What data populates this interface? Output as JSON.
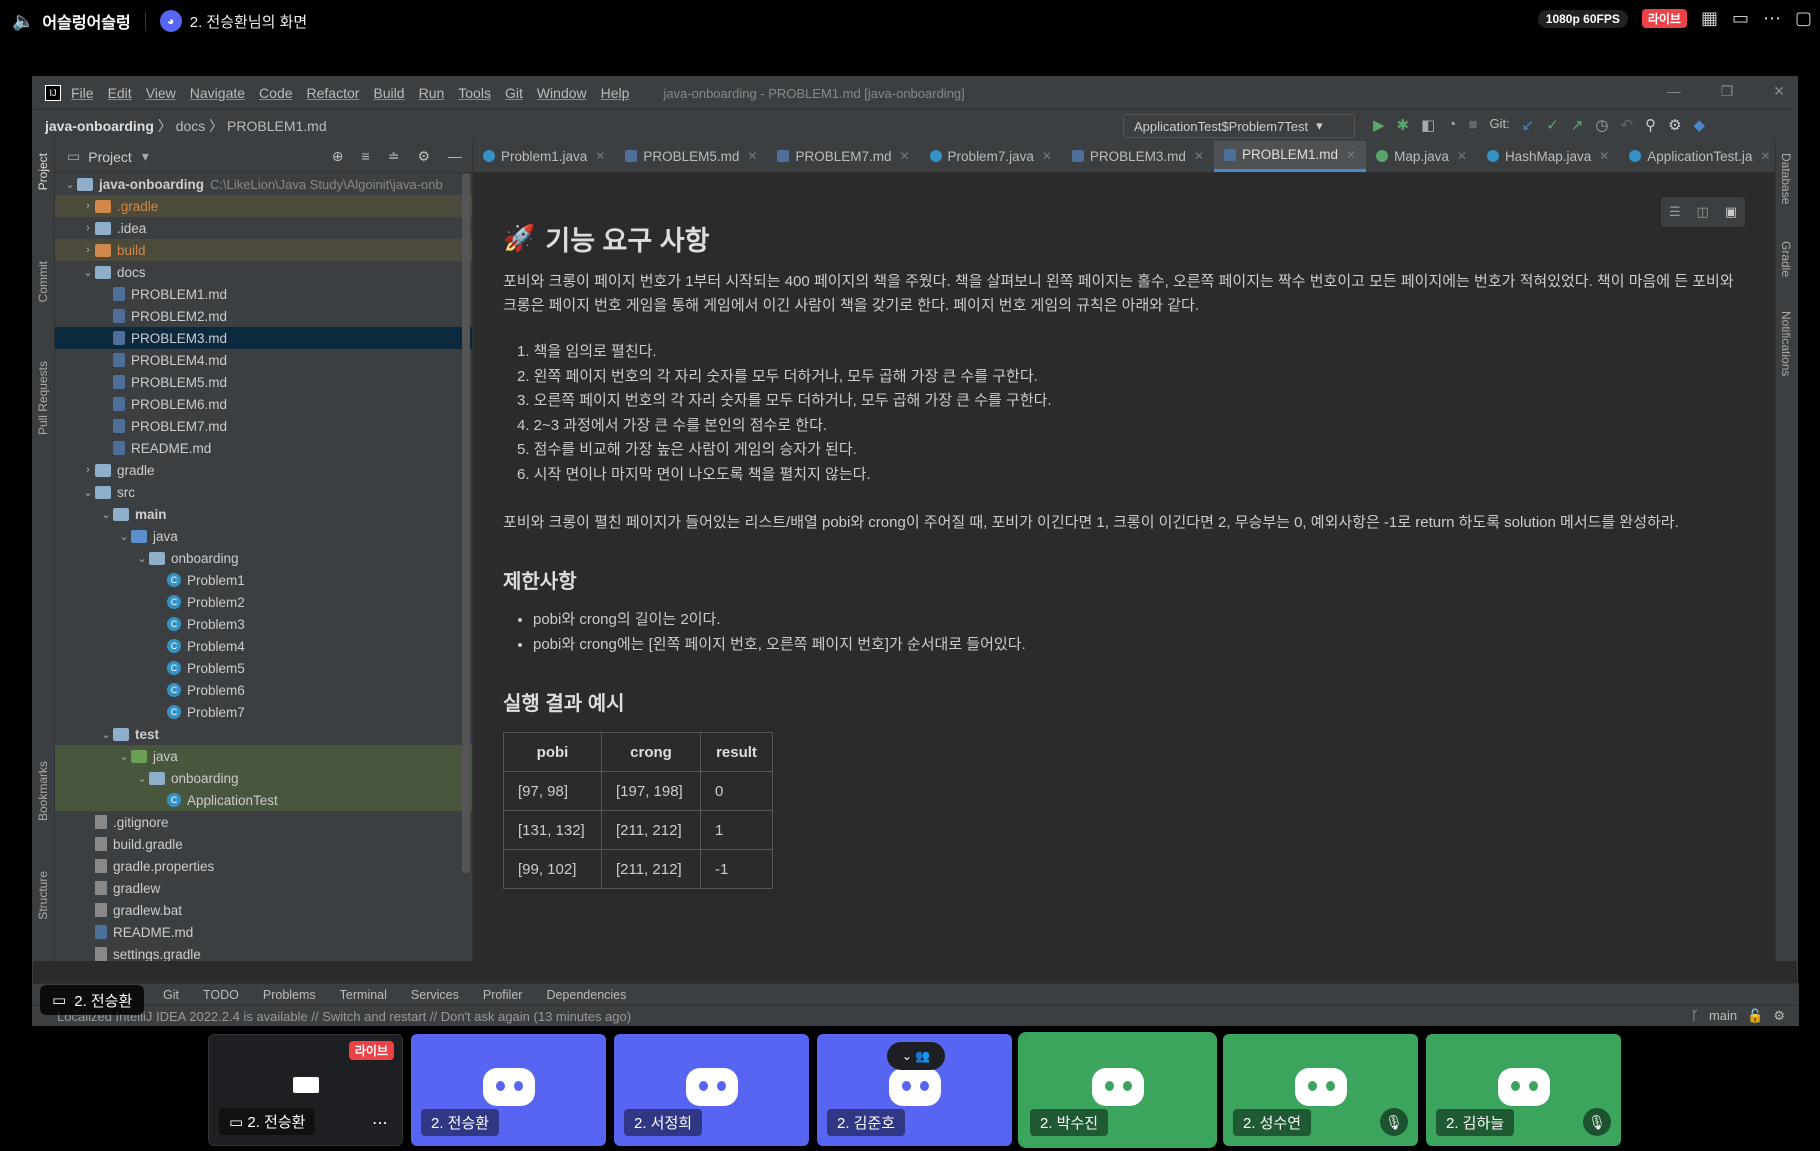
{
  "topbar": {
    "channel": "어슬렁어슬렁",
    "stream_title": "2. 전승환님의 화면",
    "quality": "1080p 60FPS",
    "live": "라이브"
  },
  "ide": {
    "menu": [
      "File",
      "Edit",
      "View",
      "Navigate",
      "Code",
      "Refactor",
      "Build",
      "Run",
      "Tools",
      "Git",
      "Window",
      "Help"
    ],
    "window_title": "java-onboarding - PROBLEM1.md [java-onboarding]",
    "breadcrumb": [
      "java-onboarding",
      "docs",
      "PROBLEM1.md"
    ],
    "run_config": "ApplicationTest$Problem7Test",
    "git_label": "Git:",
    "left_tabs": [
      "Project",
      "Commit",
      "Pull Requests",
      "Bookmarks",
      "Structure"
    ],
    "right_tabs": [
      "Database",
      "Gradle",
      "Notifications"
    ],
    "project_label": "Project",
    "tree": [
      {
        "name": "java-onboarding",
        "path": "C:\\LikeLion\\Java Study\\Algoinit\\java-onb",
        "depth": 0,
        "open": true,
        "type": "root"
      },
      {
        "name": ".gradle",
        "depth": 1,
        "open": false,
        "type": "folder-excluded"
      },
      {
        "name": ".idea",
        "depth": 1,
        "open": false,
        "type": "folder"
      },
      {
        "name": "build",
        "depth": 1,
        "open": false,
        "type": "folder-excluded"
      },
      {
        "name": "docs",
        "depth": 1,
        "open": true,
        "type": "folder"
      },
      {
        "name": "PROBLEM1.md",
        "depth": 2,
        "type": "md"
      },
      {
        "name": "PROBLEM2.md",
        "depth": 2,
        "type": "md"
      },
      {
        "name": "PROBLEM3.md",
        "depth": 2,
        "type": "md",
        "selected": true
      },
      {
        "name": "PROBLEM4.md",
        "depth": 2,
        "type": "md"
      },
      {
        "name": "PROBLEM5.md",
        "depth": 2,
        "type": "md"
      },
      {
        "name": "PROBLEM6.md",
        "depth": 2,
        "type": "md"
      },
      {
        "name": "PROBLEM7.md",
        "depth": 2,
        "type": "md"
      },
      {
        "name": "README.md",
        "depth": 2,
        "type": "md"
      },
      {
        "name": "gradle",
        "depth": 1,
        "open": false,
        "type": "folder"
      },
      {
        "name": "src",
        "depth": 1,
        "open": true,
        "type": "folder"
      },
      {
        "name": "main",
        "depth": 2,
        "open": true,
        "type": "folder"
      },
      {
        "name": "java",
        "depth": 3,
        "open": true,
        "type": "folder-src"
      },
      {
        "name": "onboarding",
        "depth": 4,
        "open": true,
        "type": "folder"
      },
      {
        "name": "Problem1",
        "depth": 5,
        "type": "class"
      },
      {
        "name": "Problem2",
        "depth": 5,
        "type": "class"
      },
      {
        "name": "Problem3",
        "depth": 5,
        "type": "class"
      },
      {
        "name": "Problem4",
        "depth": 5,
        "type": "class"
      },
      {
        "name": "Problem5",
        "depth": 5,
        "type": "class"
      },
      {
        "name": "Problem6",
        "depth": 5,
        "type": "class"
      },
      {
        "name": "Problem7",
        "depth": 5,
        "type": "class"
      },
      {
        "name": "test",
        "depth": 2,
        "open": true,
        "type": "folder"
      },
      {
        "name": "java",
        "depth": 3,
        "open": true,
        "type": "folder-test"
      },
      {
        "name": "onboarding",
        "depth": 4,
        "open": true,
        "type": "folder-test-pkg"
      },
      {
        "name": "ApplicationTest",
        "depth": 5,
        "type": "class-test"
      },
      {
        "name": ".gitignore",
        "depth": 1,
        "type": "file"
      },
      {
        "name": "build.gradle",
        "depth": 1,
        "type": "file"
      },
      {
        "name": "gradle.properties",
        "depth": 1,
        "type": "file"
      },
      {
        "name": "gradlew",
        "depth": 1,
        "type": "file"
      },
      {
        "name": "gradlew.bat",
        "depth": 1,
        "type": "file"
      },
      {
        "name": "README.md",
        "depth": 1,
        "type": "md"
      },
      {
        "name": "settings.gradle",
        "depth": 1,
        "type": "file"
      }
    ],
    "tabs": [
      {
        "label": "Problem1.java",
        "kind": "java"
      },
      {
        "label": "PROBLEM5.md",
        "kind": "md"
      },
      {
        "label": "PROBLEM7.md",
        "kind": "md"
      },
      {
        "label": "Problem7.java",
        "kind": "java"
      },
      {
        "label": "PROBLEM3.md",
        "kind": "md"
      },
      {
        "label": "PROBLEM1.md",
        "kind": "md",
        "active": true
      },
      {
        "label": "Map.java",
        "kind": "iface"
      },
      {
        "label": "HashMap.java",
        "kind": "java"
      },
      {
        "label": "ApplicationTest.ja",
        "kind": "java"
      }
    ],
    "doc": {
      "h1": "기능 요구 사항",
      "intro": "포비와 크롱이 페이지 번호가 1부터 시작되는 400 페이지의 책을 주웠다. 책을 살펴보니 왼쪽 페이지는 홀수, 오른쪽 페이지는 짝수 번호이고 모든 페이지에는 번호가 적혀있었다. 책이 마음에 든 포비와 크롱은 페이지 번호 게임을 통해 게임에서 이긴 사람이 책을 갖기로 한다. 페이지 번호 게임의 규칙은 아래와 같다.",
      "rules": [
        "1. 책을 임의로 펼친다.",
        "2. 왼쪽 페이지 번호의 각 자리 숫자를 모두 더하거나, 모두 곱해 가장 큰 수를 구한다.",
        "3. 오른쪽 페이지 번호의 각 자리 숫자를 모두 더하거나, 모두 곱해 가장 큰 수를 구한다.",
        "4. 2~3 과정에서 가장 큰 수를 본인의 점수로 한다.",
        "5. 점수를 비교해 가장 높은 사람이 게임의 승자가 된다.",
        "6. 시작 면이나 마지막 면이 나오도록 책을 펼치지 않는다."
      ],
      "task": "포비와 크롱이 펼친 페이지가 들어있는 리스트/배열 pobi와 crong이 주어질 때, 포비가 이긴다면 1, 크롱이 이긴다면 2, 무승부는 0, 예외사항은 -1로 return 하도록 solution 메서드를 완성하라.",
      "h2_constraints": "제한사항",
      "constraints": [
        "pobi와 crong의 길이는 2이다.",
        "pobi와 crong에는 [왼쪽 페이지 번호, 오른쪽 페이지 번호]가 순서대로 들어있다."
      ],
      "h2_examples": "실행 결과 예시",
      "table_headers": [
        "pobi",
        "crong",
        "result"
      ],
      "table_rows": [
        [
          "[97, 98]",
          "[197, 198]",
          "0"
        ],
        [
          "[131, 132]",
          "[211, 212]",
          "1"
        ],
        [
          "[99, 102]",
          "[211, 212]",
          "-1"
        ]
      ]
    },
    "bottom_tools": [
      "Git",
      "TODO",
      "Problems",
      "Terminal",
      "Services",
      "Profiler",
      "Dependencies"
    ],
    "status": "Localized IntelliJ IDEA 2022.2.4 is available // Switch and restart // Don't ask again (13 minutes ago)",
    "branch": "main"
  },
  "overlay_name": "2. 전승환",
  "tiles": [
    {
      "label": "2. 전승환",
      "kind": "screen"
    },
    {
      "label": "2. 전승환",
      "kind": "blue"
    },
    {
      "label": "2. 서정희",
      "kind": "blue"
    },
    {
      "label": "2. 김준호",
      "kind": "blue"
    },
    {
      "label": "2. 박수진",
      "kind": "green"
    },
    {
      "label": "2. 성수연",
      "kind": "green"
    },
    {
      "label": "2. 김하늘",
      "kind": "green"
    }
  ],
  "colors": {
    "discord_blurple": "#5865f2",
    "discord_green": "#3ba55d",
    "live_red": "#ed4245",
    "ide_bg": "#2b2b2b",
    "ide_panel": "#3c3f41"
  }
}
